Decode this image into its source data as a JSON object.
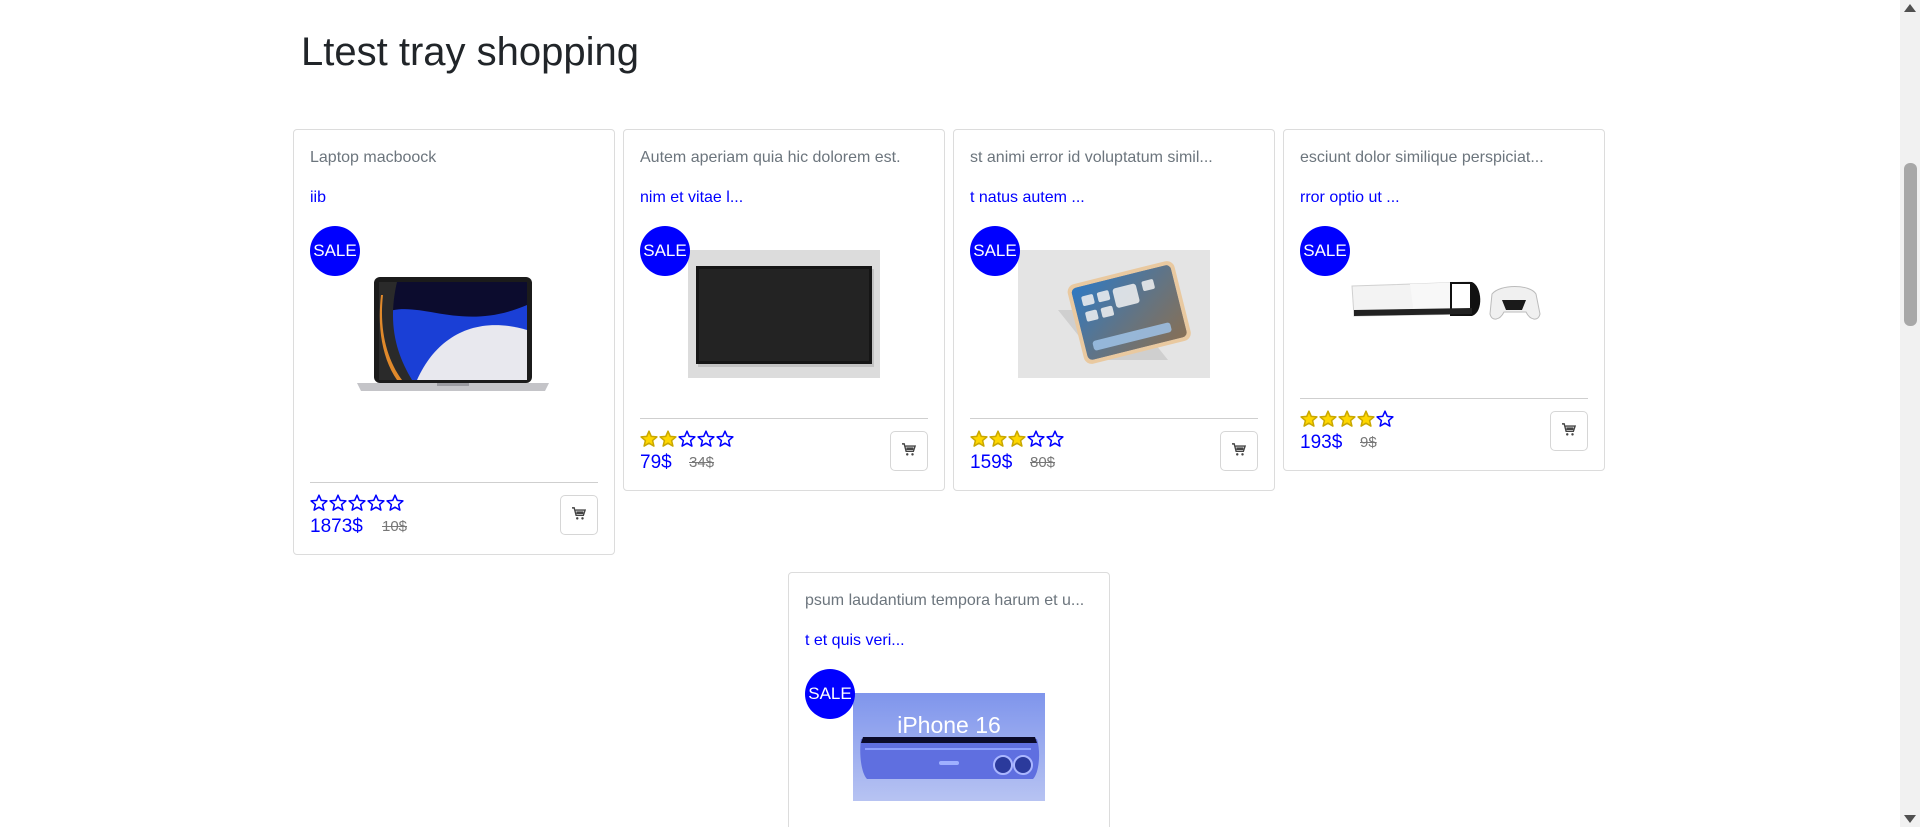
{
  "page": {
    "title": "Ltest tray shopping"
  },
  "colors": {
    "accent": "#0000ff",
    "star": "#ffd700",
    "star_outline": "#0000ff"
  },
  "products": [
    {
      "title": "Laptop macboock",
      "link": "iib",
      "badge": "SALE",
      "image": "macbook-laptop",
      "rating": 0,
      "price": "1873$",
      "old_price": "10$",
      "cart_icon": "cart-icon"
    },
    {
      "title": "Autem aperiam quia hic dolorem est.",
      "link": "nim et vitae l...",
      "badge": "SALE",
      "image": "flat-tv",
      "rating": 2,
      "price": "79$",
      "old_price": "34$",
      "cart_icon": "cart-icon"
    },
    {
      "title": "st animi error id voluptatum simil...",
      "link": "t natus autem ...",
      "badge": "SALE",
      "image": "ipad-tablet",
      "rating": 3,
      "price": "159$",
      "old_price": "80$",
      "cart_icon": "cart-icon"
    },
    {
      "title": "esciunt dolor similique perspiciat...",
      "link": "rror optio ut ...",
      "badge": "SALE",
      "image": "ps5-console",
      "rating": 4,
      "price": "193$",
      "old_price": "9$",
      "cart_icon": "cart-icon"
    },
    {
      "title": "psum laudantium tempora harum et u...",
      "link": "t et quis veri...",
      "badge": "SALE",
      "image": "iphone-16",
      "image_text": "iPhone 16"
    }
  ]
}
